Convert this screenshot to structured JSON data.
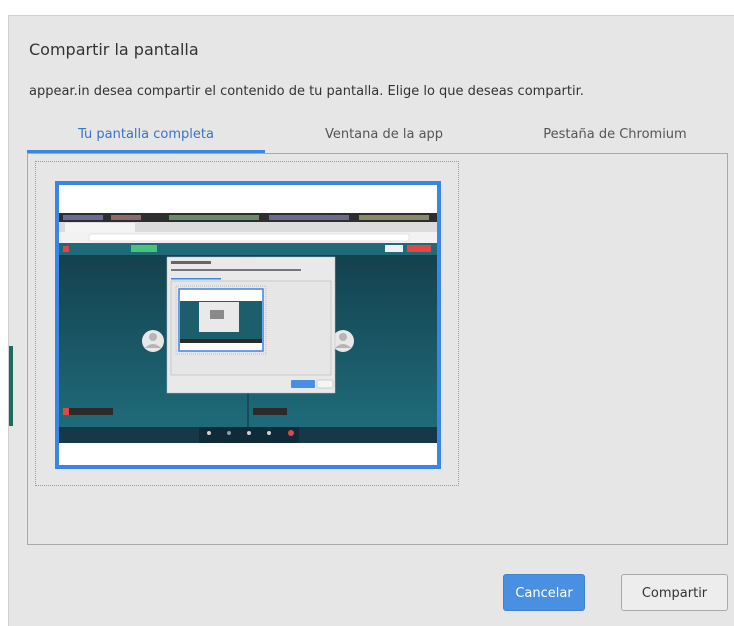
{
  "dialog": {
    "title": "Compartir la pantalla",
    "description": "appear.in desea compartir el contenido de tu pantalla. Elige lo que deseas compartir."
  },
  "tabs": [
    {
      "label": "Tu pantalla completa",
      "active": true
    },
    {
      "label": "Ventana de la app",
      "active": false
    },
    {
      "label": "Pestaña de Chromium",
      "active": false
    }
  ],
  "buttons": {
    "cancel_label": "Cancelar",
    "share_label": "Compartir"
  },
  "colors": {
    "accent": "#3a86e6",
    "dialog_bg": "#e6e6e6",
    "cancel_bg": "#4a90e2",
    "thumb_teal": "#1f6b7a",
    "thumb_red": "#e64545",
    "thumb_green": "#49c47a"
  }
}
